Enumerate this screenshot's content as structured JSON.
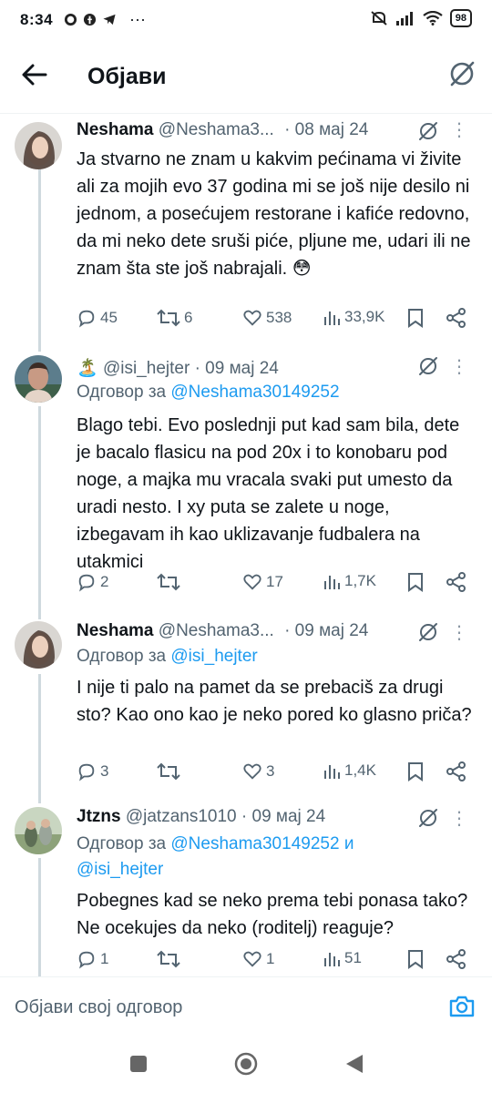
{
  "status_bar": {
    "time": "8:34",
    "icons_left": [
      "whatsapp-icon",
      "facebook-icon",
      "telegram-icon"
    ],
    "more": "···",
    "battery": "98"
  },
  "app_bar": {
    "title": "Објави"
  },
  "tweets": [
    {
      "name": "Neshama",
      "handle": "@Neshama3...",
      "date": "· 08 мај 24",
      "text": "Ja stvarno ne znam u kakvim pećinama vi živite ali za mojih evo 37 godina mi se još nije desilo ni jednom, a posećujem restorane i kafiće redovno, da mi neko dete sruši piće, pljune me, udari ili ne znam šta ste još nabrajali. 😳",
      "replies": "45",
      "retweets": "6",
      "likes": "538",
      "views": "33,9K"
    },
    {
      "emoji": "🏝️",
      "handle": "@isi_hejter",
      "date": "· 09 мај 24",
      "reply_prefix": "Одговор за",
      "reply_to": "@Neshama30149252",
      "text": "Blago tebi. Evo poslednji put kad sam bila, dete je bacalo flasicu na pod 20x i to konobaru pod noge, a majka mu vracala svaki put umesto da uradi nesto. I xy puta se zalete u noge, izbegavam ih kao uklizavanje fudbalera na utakmici",
      "replies": "2",
      "retweets": "",
      "likes": "17",
      "views": "1,7K"
    },
    {
      "name": "Neshama",
      "handle": "@Neshama3...",
      "date": "· 09 мај 24",
      "reply_prefix": "Одговор за",
      "reply_to": "@isi_hejter",
      "text": "I nije ti palo na pamet da se prebaciš za drugi sto? Kao ono kao je neko pored ko glasno priča?",
      "replies": "3",
      "retweets": "",
      "likes": "3",
      "views": "1,4K"
    },
    {
      "name": "Jtzns",
      "handle": "@jatzans1010",
      "date": "· 09 мај 24",
      "reply_prefix": "Одговор за",
      "reply_to": "@Neshama30149252",
      "reply_and": "и",
      "reply_to_2": "@isi_hejter",
      "text": "Pobegnes kad se neko prema tebi ponasa tako? Ne ocekujes da neko (roditelj) reaguje?",
      "replies": "1",
      "retweets": "",
      "likes": "1",
      "views": "51"
    }
  ],
  "composer": {
    "placeholder": "Објави свој одговор"
  },
  "colors": {
    "link": "#1d9bf0",
    "secondary_text": "#536471",
    "thread_line": "#cfd9de"
  }
}
